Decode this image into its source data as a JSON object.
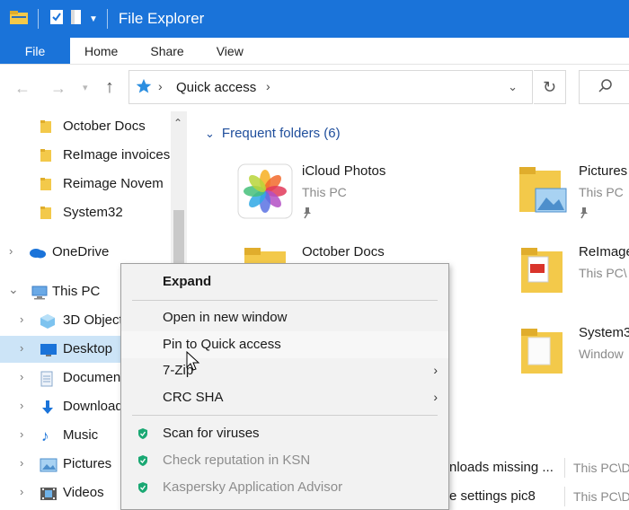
{
  "window": {
    "title": "File Explorer",
    "accent": "#1a73d9"
  },
  "ribbon": {
    "tabs": [
      "File",
      "Home",
      "Share",
      "View"
    ]
  },
  "address": {
    "location": "Quick access"
  },
  "navpane": {
    "items": [
      {
        "label": "October Docs",
        "icon": "folder-icon"
      },
      {
        "label": "ReImage invoices",
        "icon": "folder-icon"
      },
      {
        "label": "Reimage Novem",
        "icon": "folder-icon"
      },
      {
        "label": "System32",
        "icon": "folder-icon"
      },
      {
        "label": "OneDrive",
        "icon": "onedrive-icon"
      },
      {
        "label": "This PC",
        "icon": "this-pc-icon"
      },
      {
        "label": "3D Objects",
        "icon": "3d-objects-icon"
      },
      {
        "label": "Desktop",
        "icon": "desktop-icon"
      },
      {
        "label": "Documents",
        "icon": "documents-icon"
      },
      {
        "label": "Downloads",
        "icon": "downloads-icon"
      },
      {
        "label": "Music",
        "icon": "music-icon"
      },
      {
        "label": "Pictures",
        "icon": "pictures-icon"
      },
      {
        "label": "Videos",
        "icon": "videos-icon"
      }
    ]
  },
  "content": {
    "group_header": "Frequent folders (6)",
    "folders": [
      {
        "name": "iCloud Photos",
        "location": "This PC"
      },
      {
        "name": "Pictures",
        "location": "This PC"
      },
      {
        "name": "October Docs",
        "location": ""
      },
      {
        "name": "ReImage",
        "location": "This PC\\"
      },
      {
        "name": "System3",
        "location": "Window"
      }
    ],
    "recent": [
      {
        "name": "nloads missing ...",
        "path": "This PC\\D"
      },
      {
        "name": "e settings pic8",
        "path": "This PC\\D"
      }
    ]
  },
  "context_menu": {
    "items": [
      {
        "label": "Expand"
      },
      {
        "label": "Open in new window"
      },
      {
        "label": "Pin to Quick access"
      },
      {
        "label": "7-Zip"
      },
      {
        "label": "CRC SHA"
      },
      {
        "label": "Scan for viruses"
      },
      {
        "label": "Check reputation in KSN"
      },
      {
        "label": "Kaspersky Application Advisor"
      }
    ]
  }
}
